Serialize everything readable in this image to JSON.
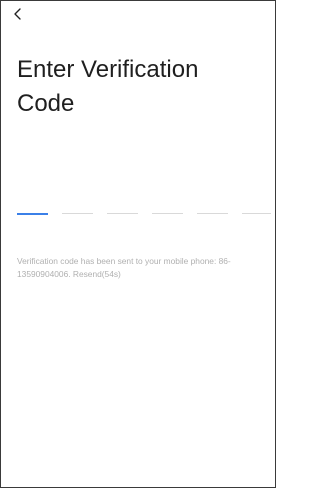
{
  "header": {
    "back_icon": "chevron-left-icon"
  },
  "title": "Enter Verification Code",
  "code_input": {
    "slots": 6,
    "active_slot": 1,
    "colors": {
      "active": "#3b80e8",
      "inactive": "#d9d9d9"
    }
  },
  "info": {
    "message": "Verification code has been sent to your mobile phone: 86-13590904006.",
    "resend_label": "Resend(54s)"
  }
}
